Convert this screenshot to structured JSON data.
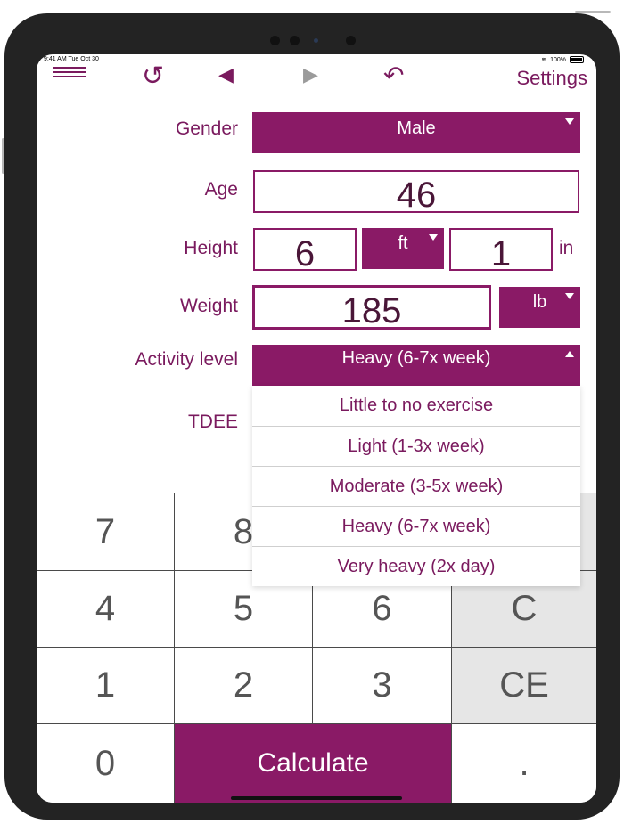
{
  "status_bar": {
    "time": "9:41 AM  Tue Oct 30",
    "battery": "100%"
  },
  "toolbar": {
    "menu_icon": "menu-icon",
    "reset_glyph": "↺",
    "back_glyph": "◀",
    "forward_glyph": "▶",
    "undo_glyph": "↶",
    "settings_label": "Settings"
  },
  "form": {
    "gender": {
      "label": "Gender",
      "value": "Male"
    },
    "age": {
      "label": "Age",
      "value": "46"
    },
    "height": {
      "label": "Height",
      "feet_value": "6",
      "feet_unit": "ft",
      "inches_value": "1",
      "inches_unit": "in"
    },
    "weight": {
      "label": "Weight",
      "value": "185",
      "unit": "lb"
    },
    "activity": {
      "label": "Activity level",
      "value": "Heavy (6-7x week)"
    },
    "tdee": {
      "label": "TDEE"
    }
  },
  "activity_options": [
    "Little to no exercise",
    "Light (1-3x week)",
    "Moderate (3-5x week)",
    "Heavy (6-7x week)",
    "Very heavy (2x day)"
  ],
  "keypad": {
    "k7": "7",
    "k8": "8",
    "k4": "4",
    "k5": "5",
    "k6": "6",
    "clear": "C",
    "k1": "1",
    "k2": "2",
    "k3": "3",
    "clear_entry": "CE",
    "k0": "0",
    "calculate": "Calculate",
    "dot": "."
  },
  "colors": {
    "accent": "#8a1a66",
    "text": "#7a1a5e",
    "key_gray": "#e6e6e6"
  }
}
